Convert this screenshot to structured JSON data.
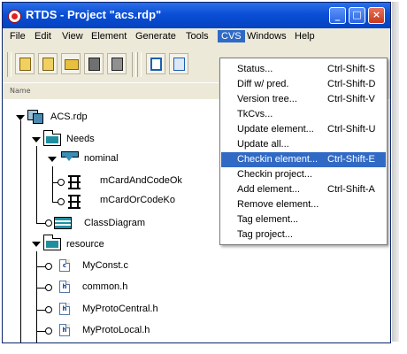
{
  "window": {
    "title": "RTDS - Project \"acs.rdp\""
  },
  "menubar": {
    "items": [
      "File",
      "Edit",
      "View",
      "Element",
      "Generate",
      "Tools",
      "CVS",
      "Windows",
      "Help"
    ]
  },
  "toolbar": {
    "icons": [
      "project-icon",
      "zip-icon",
      "open-folder-icon",
      "save-icon",
      "save-all-icon",
      "checkbox-icon",
      "checkin-icon"
    ]
  },
  "column_header": {
    "name": "Name"
  },
  "tree": {
    "root": "ACS.rdp",
    "needs": "Needs",
    "nominal": "nominal",
    "card_ok": "mCardAndCodeOk",
    "card_ko": "mCardOrCodeKo",
    "class_diagram": "ClassDiagram",
    "resource": "resource",
    "my_const": "MyConst.c",
    "common_h": "common.h",
    "proto_central": "MyProtoCentral.h",
    "proto_local": "MyProtoLocal.h",
    "file_ext_c": "c",
    "file_ext_h": "h"
  },
  "cvs_menu": {
    "status": {
      "label": "Status...",
      "shortcut": "Ctrl-Shift-S"
    },
    "diff": {
      "label": "Diff w/ pred.",
      "shortcut": "Ctrl-Shift-D"
    },
    "version_tree": {
      "label": "Version tree...",
      "shortcut": "Ctrl-Shift-V"
    },
    "tkcvs": {
      "label": "TkCvs..."
    },
    "update_element": {
      "label": "Update element...",
      "shortcut": "Ctrl-Shift-U"
    },
    "update_all": {
      "label": "Update all..."
    },
    "checkin_element": {
      "label": "Checkin element...",
      "shortcut": "Ctrl-Shift-E"
    },
    "checkin_project": {
      "label": "Checkin project..."
    },
    "add_element": {
      "label": "Add element...",
      "shortcut": "Ctrl-Shift-A"
    },
    "remove_element": {
      "label": "Remove element..."
    },
    "tag_element": {
      "label": "Tag element..."
    },
    "tag_project": {
      "label": "Tag project..."
    }
  },
  "colors": {
    "titlebar": "#0a4fd6",
    "highlight": "#316ac5",
    "folder_teal": "#1f8fa0"
  }
}
